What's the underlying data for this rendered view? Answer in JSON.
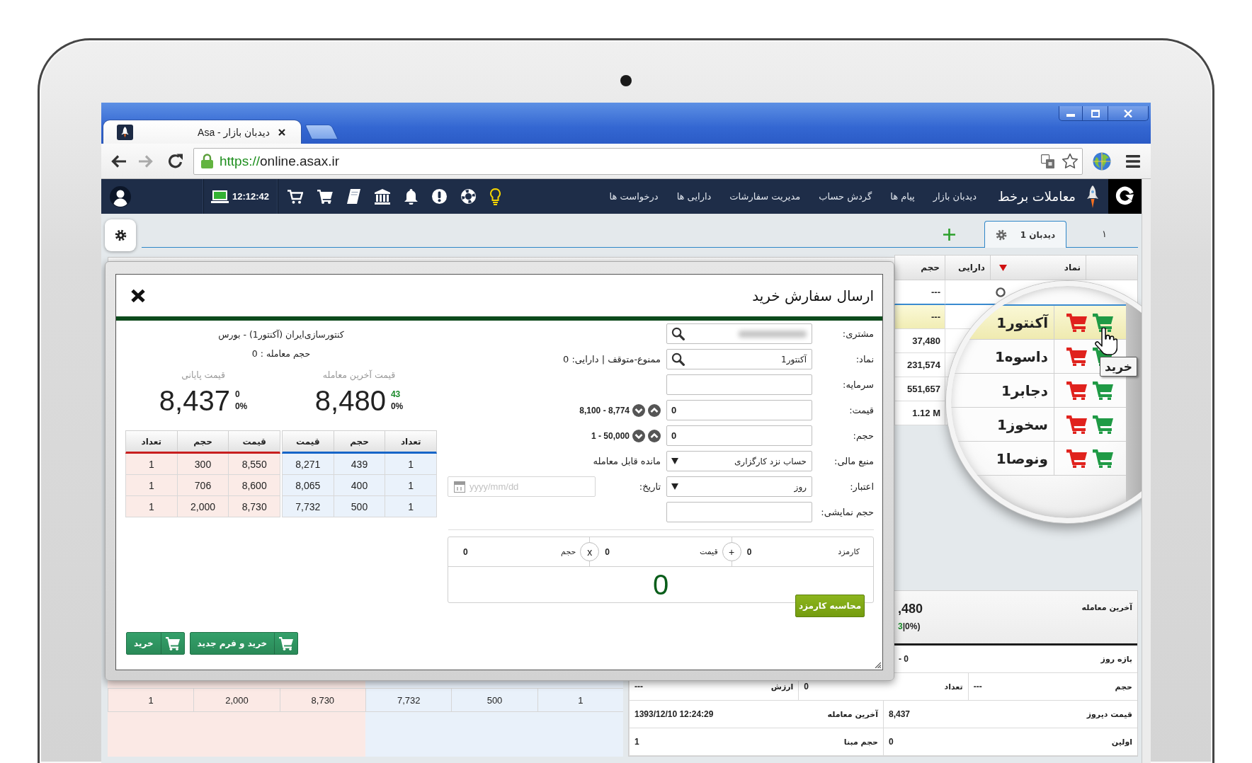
{
  "browser": {
    "tab_title": "دیدبان بازار - Asa",
    "url_scheme": "https://",
    "url_host": "online.asax.ir"
  },
  "navbar": {
    "brand": "معاملات برخط",
    "menu": [
      {
        "label": "دیدبان بازار"
      },
      {
        "label": "پیام ها"
      },
      {
        "label": "گردش حساب"
      },
      {
        "label": "مدیریت سفارشات"
      },
      {
        "label": "دارایی ها"
      },
      {
        "label": "درخواست ها"
      }
    ],
    "clock": "12:12:42"
  },
  "tabs": [
    {
      "label": "١",
      "selected": false
    },
    {
      "label": "دیدبان 1",
      "selected": true
    }
  ],
  "watchlist": {
    "columns": [
      {
        "label": "نماد",
        "sorted": true
      },
      {
        "label": "دارایی",
        "sorted": false
      },
      {
        "label": "حجم",
        "sorted": false
      }
    ],
    "rows": [
      {
        "kind": "filter",
        "volume": "---",
        "selected": false
      },
      {
        "kind": "symbol",
        "symbol": "آکنتور1",
        "volume": "---",
        "selected": true
      },
      {
        "kind": "symbol",
        "symbol": "داسوه1",
        "volume": "37,480",
        "selected": false
      },
      {
        "kind": "symbol",
        "symbol": "دجابر1",
        "volume": "231,574",
        "selected": false
      },
      {
        "kind": "symbol",
        "symbol": "سخوز1",
        "volume": "551,657",
        "selected": false
      },
      {
        "kind": "symbol",
        "symbol": "ونوصا1",
        "volume": "1.12 M",
        "selected": false
      }
    ],
    "tooltip": "خرید"
  },
  "dialog": {
    "title": "ارسال سفارش خرید",
    "symbol_name": "کنتورسازی‌ایران (آکنتور1) - بورس",
    "trade_volume": "حجم معامله : 0",
    "prices": [
      {
        "label": "قیمت آخرین معامله",
        "value": "8,480",
        "change": "43",
        "percent": "0%",
        "rising": true
      },
      {
        "label": "قیمت پایانی",
        "value": "8,437",
        "change": "0",
        "percent": "0%",
        "rising": false
      }
    ],
    "order_book": [
      {
        "kind": "buy",
        "columns": [
          "تعداد",
          "حجم",
          "قیمت"
        ],
        "rows": [
          [
            "1",
            "439",
            "8,271"
          ],
          [
            "1",
            "400",
            "8,065"
          ],
          [
            "1",
            "500",
            "7,732"
          ]
        ]
      },
      {
        "kind": "sell",
        "columns": [
          "قیمت",
          "حجم",
          "تعداد"
        ],
        "rows": [
          [
            "8,550",
            "300",
            "1"
          ],
          [
            "8,600",
            "706",
            "1"
          ],
          [
            "8,730",
            "2,000",
            "1"
          ]
        ]
      }
    ],
    "buttons": [
      {
        "label": "خرید و فرم جدید"
      },
      {
        "label": "خرید"
      }
    ],
    "form": [
      {
        "kind": "search",
        "label": "مشتری:",
        "redacted": true
      },
      {
        "kind": "search",
        "label": "نماد:",
        "value": "آکنتور1",
        "note": "ممنوع-متوقف | دارایی: 0",
        "redacted": false
      },
      {
        "kind": "text",
        "label": "سرمایه:",
        "redacted": false
      },
      {
        "kind": "spinner",
        "label": "قیمت:",
        "value": "0",
        "range": "8,100 - 8,774",
        "redacted": false
      },
      {
        "kind": "spinner",
        "label": "حجم:",
        "value": "0",
        "range": "1 - 50,000",
        "redacted": false
      },
      {
        "kind": "select",
        "label": "منبع مالی:",
        "value": "حساب نزد کارگزاری",
        "note": "مانده قابل معامله",
        "redacted": false
      },
      {
        "kind": "select",
        "label": "اعتبار:",
        "value": "روز",
        "date_label": "تاریخ:",
        "date_placeholder": "yyyy/mm/dd",
        "redacted": false
      },
      {
        "kind": "text",
        "label": "حجم نمایشی:",
        "redacted": false
      }
    ],
    "fee": {
      "cells": [
        {
          "label": "کارمزد",
          "value": "0"
        },
        {
          "label": "قیمت",
          "value": "0"
        },
        {
          "label": "حجم",
          "value": "0"
        }
      ],
      "operators": [
        "+",
        "x"
      ],
      "total": "0",
      "button": "محاسبه کارمزد"
    }
  },
  "market_depth": [
    {
      "kind": "buy",
      "cells": [
        "1",
        "500",
        "7,732"
      ]
    },
    {
      "kind": "sell",
      "cells": [
        "8,730",
        "2,000",
        "1"
      ]
    }
  ],
  "info_panel": {
    "last_trade": {
      "label": "آخرین معامله",
      "value": ",480",
      "change": "3",
      "percent": "|0%)",
      "rising": true
    },
    "rows": [
      [
        {
          "label": "بازه روز",
          "value": "- 0"
        }
      ],
      [
        {
          "label": "حجم",
          "value": "---"
        },
        {
          "label": "تعداد",
          "value": "0"
        },
        {
          "label": "ارزش",
          "value": "---"
        }
      ],
      [
        {
          "label": "قیمت دیروز",
          "value": "8,437"
        },
        {
          "label": "آخرین معامله",
          "value": "1393/12/10 12:24:29"
        }
      ],
      [
        {
          "label": "اولین",
          "value": "0"
        },
        {
          "label": "حجم مبنا",
          "value": "1"
        }
      ]
    ]
  }
}
